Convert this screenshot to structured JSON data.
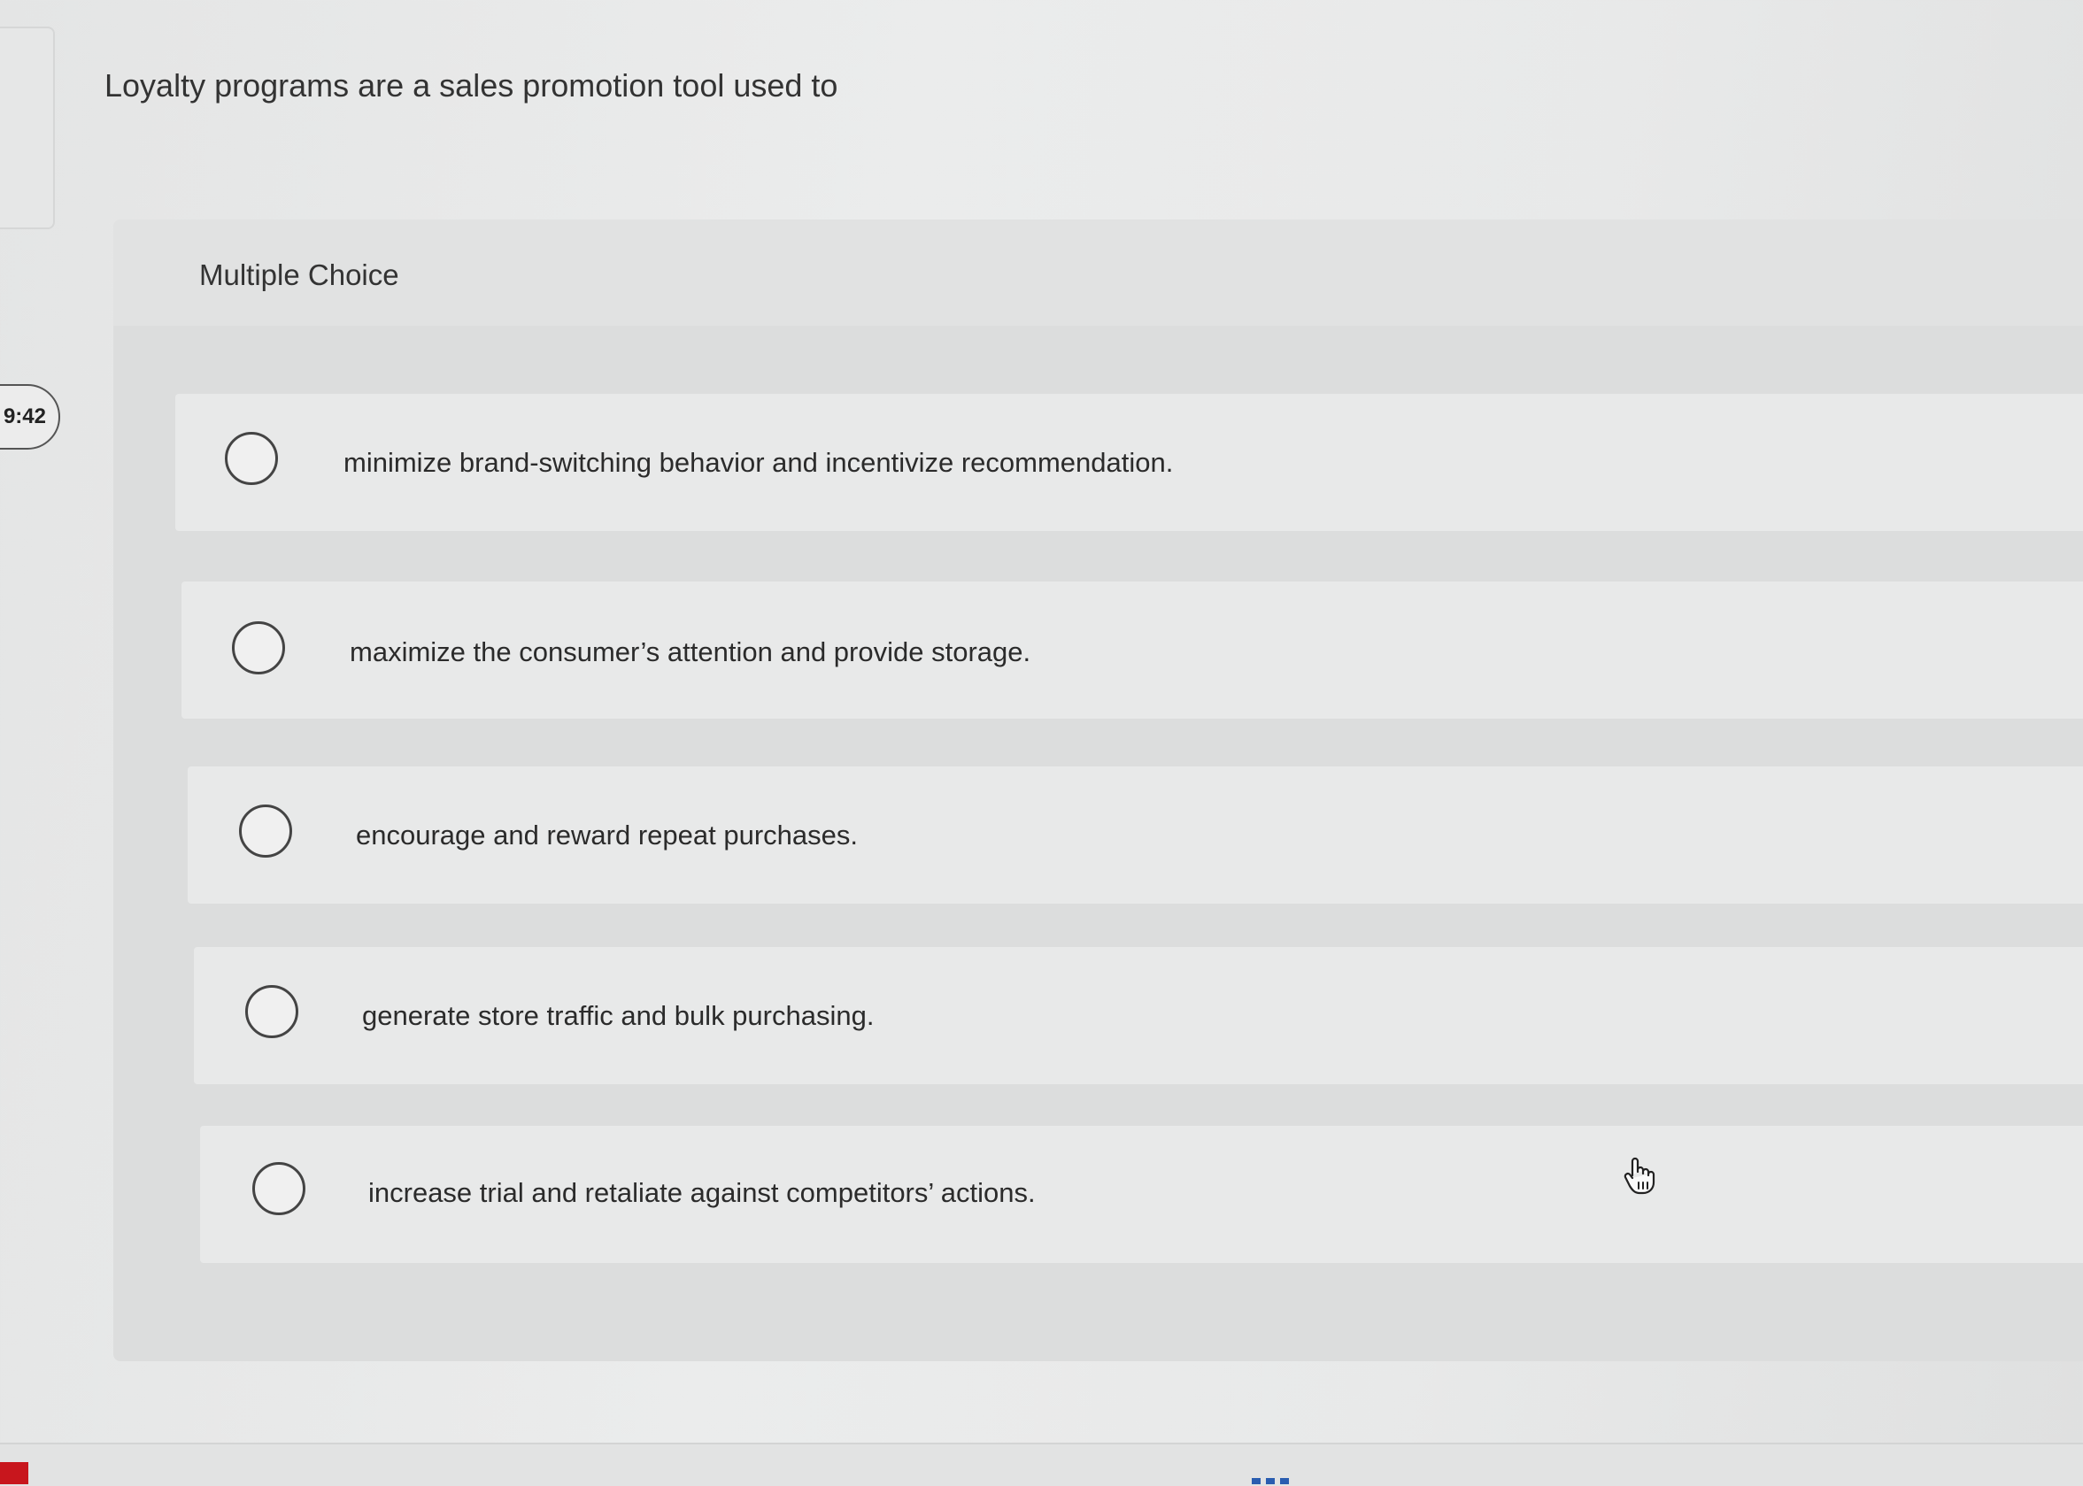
{
  "question": {
    "text": "Loyalty programs are a sales promotion tool used to"
  },
  "timer": {
    "value": "9:42"
  },
  "panel": {
    "label": "Multiple Choice"
  },
  "options": [
    {
      "label": "minimize brand-switching behavior and incentivize recommendation.",
      "selected": false
    },
    {
      "label": "maximize the consumer’s attention and provide storage.",
      "selected": false
    },
    {
      "label": "encourage and reward repeat purchases.",
      "selected": false
    },
    {
      "label": "generate store traffic and bulk purchasing.",
      "selected": false
    },
    {
      "label": "increase trial and retaliate against competitors’ actions.",
      "selected": false
    }
  ],
  "icons": {
    "cursor": "hand-pointer-icon"
  },
  "colors": {
    "background": "#e8e9e9",
    "panel": "#dcdddd",
    "option_row": "#e8e9e9",
    "text": "#2b2b2b",
    "radio_border": "#444444",
    "accent_red": "#c8161d",
    "accent_blue": "#2a5db0"
  }
}
